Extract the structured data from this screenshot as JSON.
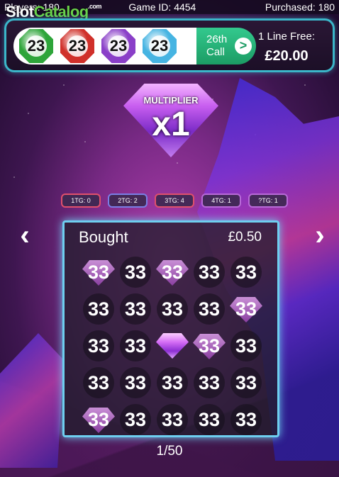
{
  "logo": {
    "part1": "Slot",
    "part2": "Catalog",
    "suffix": ".com"
  },
  "topbar": {
    "players": "Players: 180",
    "game_id": "Game ID: 4454",
    "purchased": "Purchased: 180"
  },
  "balls": [
    {
      "number": "23",
      "color": "#2ea53a"
    },
    {
      "number": "23",
      "color": "#d0302a"
    },
    {
      "number": "23",
      "color": "#8a3fc8"
    },
    {
      "number": "23",
      "color": "#46b4e2"
    }
  ],
  "call": {
    "line1": "26th",
    "line2": "Call",
    "chevron": ">"
  },
  "line_free": {
    "label": "1 Line Free:",
    "amount": "£20.00"
  },
  "multiplier": {
    "label": "MULTIPLIER",
    "value": "x1"
  },
  "tg_chips": [
    {
      "label": "1TG: 0",
      "color": "#e0506c"
    },
    {
      "label": "2TG: 2",
      "color": "#7a7ee6"
    },
    {
      "label": "3TG: 4",
      "color": "#e0506c"
    },
    {
      "label": "4TG: 1",
      "color": "#b86ad8"
    },
    {
      "label": "?TG: 1",
      "color": "#b86ad8"
    }
  ],
  "nav": {
    "prev": "‹",
    "next": "›"
  },
  "card": {
    "title": "Bought",
    "price": "£0.50",
    "cells": [
      [
        "33",
        "33",
        "33",
        "33",
        "33"
      ],
      [
        "33",
        "33",
        "33",
        "33",
        "33"
      ],
      [
        "33",
        "33",
        "",
        "33",
        "33"
      ],
      [
        "33",
        "33",
        "33",
        "33",
        "33"
      ],
      [
        "33",
        "33",
        "33",
        "33",
        "33"
      ]
    ],
    "marked": [
      [
        true,
        false,
        true,
        false,
        false
      ],
      [
        false,
        false,
        false,
        false,
        true
      ],
      [
        false,
        false,
        false,
        true,
        false
      ],
      [
        false,
        false,
        false,
        false,
        false
      ],
      [
        true,
        false,
        false,
        false,
        false
      ]
    ]
  },
  "pager": "1/50"
}
